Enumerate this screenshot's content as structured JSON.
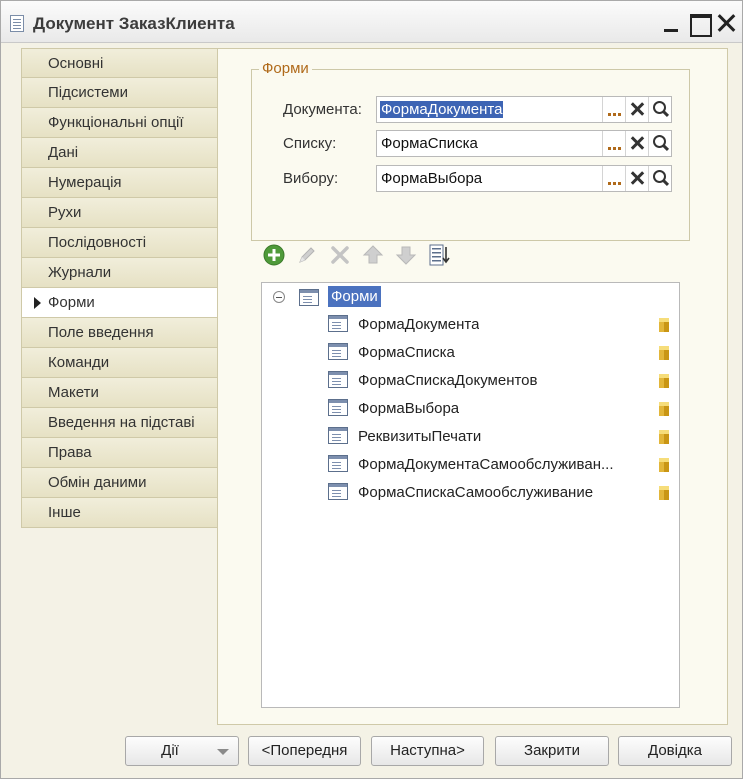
{
  "window": {
    "title": "Документ ЗаказКлиента"
  },
  "sidebar": {
    "items": [
      {
        "label": "Основні"
      },
      {
        "label": "Підсистеми"
      },
      {
        "label": "Функціональні опції"
      },
      {
        "label": "Дані"
      },
      {
        "label": "Нумерація"
      },
      {
        "label": "Рухи"
      },
      {
        "label": "Послідовності"
      },
      {
        "label": "Журнали"
      },
      {
        "label": "Форми",
        "active": true
      },
      {
        "label": "Поле введення"
      },
      {
        "label": "Команди"
      },
      {
        "label": "Макети"
      },
      {
        "label": "Введення на підставі"
      },
      {
        "label": "Права"
      },
      {
        "label": "Обмін даними"
      },
      {
        "label": "Інше"
      }
    ]
  },
  "forms_group": {
    "legend": "Форми",
    "fields": [
      {
        "label": "Документа:",
        "value": "ФормаДокумента"
      },
      {
        "label": "Списку:",
        "value": "ФормаСписка"
      },
      {
        "label": "Вибору:",
        "value": "ФормаВыбора"
      }
    ]
  },
  "toolbar": {
    "icons": [
      "add-icon",
      "edit-icon",
      "delete-icon",
      "move-up-icon",
      "move-down-icon",
      "sort-icon"
    ]
  },
  "tree": {
    "root": "Форми",
    "items": [
      {
        "label": "ФормаДокумента"
      },
      {
        "label": "ФормаСписка"
      },
      {
        "label": "ФормаСпискаДокументов"
      },
      {
        "label": "ФормаВыбора"
      },
      {
        "label": "РеквизитыПечати"
      },
      {
        "label": "ФормаДокументаСамообслуживан..."
      },
      {
        "label": "ФормаСпискаСамообслуживание"
      }
    ]
  },
  "buttons": {
    "actions": "Дії",
    "previous": "<Попередня",
    "next": "Наступна>",
    "close": "Закрити",
    "help": "Довідка"
  },
  "colors": {
    "selection": "#3d64b4",
    "legend": "#b06a1a",
    "nav_bg": "#e6e1c4"
  }
}
